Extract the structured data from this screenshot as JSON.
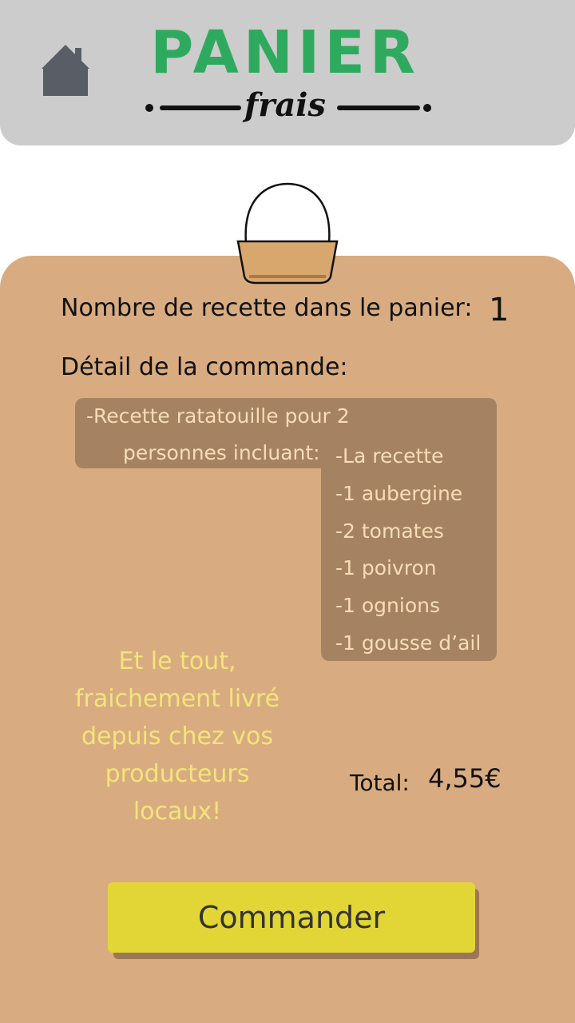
{
  "header": {
    "home_icon": "home-icon",
    "logo_title": "PANIER",
    "logo_subtitle": "frais",
    "background_color": "#cccccc",
    "logo_color": "#2eaa5e"
  },
  "basket_icon": "basket-icon",
  "cart": {
    "count_label": "Nombre de recette dans le panier:",
    "count_value": "1",
    "detail_title": "Détail de la commande:",
    "recipe_line1": "-Recette ratatouille pour 2",
    "recipe_line2": "personnes incluant:",
    "ingredients": [
      "-La recette",
      "-1 aubergine",
      "-2 tomates",
      "-1 poivron",
      "-1 ognions",
      "-1 gousse d’ail"
    ]
  },
  "promo_lines": [
    "Et le tout,",
    "fraichement livré",
    "depuis chez vos",
    "producteurs",
    "locaux!"
  ],
  "total": {
    "label": "Total:",
    "value": "4,55€"
  },
  "order_button": {
    "label": "Commander",
    "color": "#e2d636"
  },
  "colors": {
    "panel": "#d8ac80",
    "detail_box": "#a58362",
    "promo_text": "#f4e47a"
  }
}
